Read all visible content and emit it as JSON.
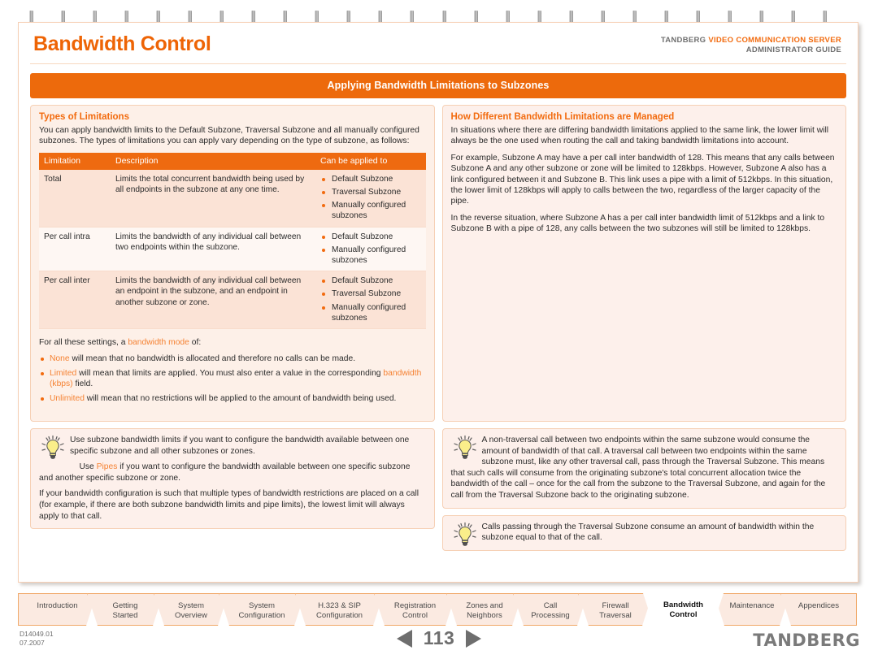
{
  "header": {
    "page_title": "Bandwidth Control",
    "crumb_brand": "TANDBERG",
    "crumb_product": "VIDEO COMMUNICATION SERVER",
    "crumb_sub": "ADMINISTRATOR GUIDE"
  },
  "banner": {
    "label": "Applying Bandwidth Limitations to Subzones"
  },
  "left_panel": {
    "title": "Types of Limitations",
    "intro": "You can apply bandwidth limits to the Default Subzone, Traversal Subzone and all manually configured subzones.  The types of limitations you can apply vary depending on the type of subzone, as follows:",
    "table": {
      "columns": [
        "Limitation",
        "Description",
        "Can be applied to"
      ],
      "rows": [
        {
          "limitation": "Total",
          "description": "Limits the total concurrent bandwidth being used by all endpoints in the subzone at any one time.",
          "applies": [
            "Default Subzone",
            "Traversal Subzone",
            "Manually configured subzones"
          ]
        },
        {
          "limitation": "Per call intra",
          "description": "Limits the bandwidth of any individual call between two endpoints within the subzone.",
          "applies": [
            "Default Subzone",
            "Manually configured subzones"
          ]
        },
        {
          "limitation": "Per call inter",
          "description": "Limits the bandwidth of any individual call between an endpoint in the subzone, and an endpoint in another subzone or zone.",
          "applies": [
            "Default Subzone",
            "Traversal Subzone",
            "Manually configured subzones"
          ]
        }
      ]
    },
    "modes_lead_pre": "For all these settings, a ",
    "modes_lead_kw": "bandwidth mode",
    "modes_lead_post": " of:",
    "modes": [
      {
        "kw": "None",
        "text": " will mean that no bandwidth is allocated and therefore no calls can be made."
      },
      {
        "kw": "Limited",
        "text": " will mean that limits are applied.  You must also enter a value in the corresponding ",
        "kw2": "bandwidth (kbps)",
        "text2": " field."
      },
      {
        "kw": "Unlimited",
        "text": " will mean that no restrictions will be applied to the amount of bandwidth being used."
      }
    ]
  },
  "right_panel": {
    "title": "How Different Bandwidth Limitations are Managed",
    "paragraphs": [
      "In situations where there are differing bandwidth limitations applied to the same link, the lower limit will always be the one used when routing the call and taking bandwidth limitations into account.",
      "For example, Subzone A may have a per call inter bandwidth of 128.  This means that any calls between Subzone A and any other subzone or zone will be limited to 128kbps.  However, Subzone A also has a link configured between it and Subzone B.  This link uses a pipe with a limit of 512kbps.  In this situation, the lower limit of 128kbps will apply to calls between the two, regardless of the larger capacity of the pipe.",
      "In the reverse situation, where Subzone A has a per call inter bandwidth limit of 512kbps and a link to Subzone B with a pipe of 128, any calls between the two subzones will still be limited to 128kbps."
    ]
  },
  "tips_left": [
    {
      "p1": "Use subzone bandwidth limits if you want to configure the bandwidth available between one specific subzone and all other subzones or zones.",
      "p2_pre": "Use ",
      "p2_kw": "Pipes",
      "p2_post": " if you want to configure the bandwidth available between one specific subzone and another specific subzone or zone.",
      "p3": "If your bandwidth configuration is such that multiple types of bandwidth restrictions are placed on a call (for example, if there are both subzone bandwidth limits and pipe limits), the lowest limit will always apply to that call."
    }
  ],
  "tips_right": [
    {
      "p1": "A non-traversal call between two endpoints within the same subzone would consume the amount of bandwidth of that call.  A traversal call between two endpoints within the same subzone must, like any other traversal call, pass through the Traversal Subzone.  This means that such calls will consume from the originating subzone's total concurrent allocation twice the bandwidth of the call – once for the call from the subzone to the Traversal Subzone, and again for the call from the Traversal Subzone back to the originating subzone."
    },
    {
      "p1": "Calls passing through the Traversal Subzone consume an amount of bandwidth within the subzone equal to that of the call."
    }
  ],
  "tabs": [
    {
      "label": "Introduction",
      "active": false
    },
    {
      "label": "Getting\nStarted",
      "active": false
    },
    {
      "label": "System\nOverview",
      "active": false
    },
    {
      "label": "System\nConfiguration",
      "active": false
    },
    {
      "label": "H.323 & SIP\nConfiguration",
      "active": false
    },
    {
      "label": "Registration\nControl",
      "active": false
    },
    {
      "label": "Zones and\nNeighbors",
      "active": false
    },
    {
      "label": "Call\nProcessing",
      "active": false
    },
    {
      "label": "Firewall\nTraversal",
      "active": false
    },
    {
      "label": "Bandwidth\nControl",
      "active": true
    },
    {
      "label": "Maintenance",
      "active": false
    },
    {
      "label": "Appendices",
      "active": false
    }
  ],
  "footer": {
    "doc_id": "D14049.01",
    "doc_date": "07.2007",
    "page_number": "113",
    "prev_icon": "left-triangle-icon",
    "next_icon": "right-triangle-icon",
    "brand": "TANDBERG"
  },
  "colors": {
    "accent": "#EE6405",
    "banner": "#ED6A0C",
    "panel_bg": "#FDF0E8",
    "panel_border": "#F6D0B5",
    "table_header": "#EE6A10",
    "keyword": "#F58233",
    "tab_bg": "#FBEAE1",
    "tab_border": "#F0A868",
    "footer_gray": "#6e6e6e"
  }
}
